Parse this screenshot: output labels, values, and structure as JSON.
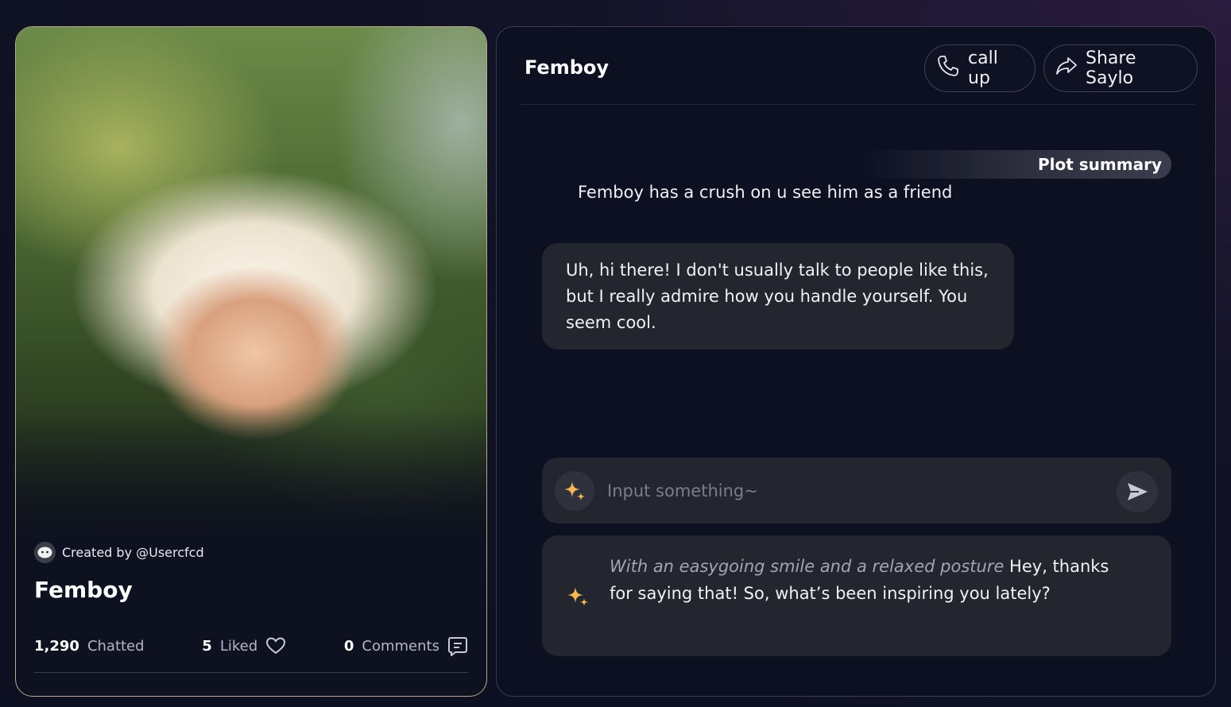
{
  "character_card": {
    "creator_label": "Created by @Usercfcd",
    "name": "Femboy",
    "stats": {
      "chatted_count": "1,290",
      "chatted_label": "Chatted",
      "liked_count": "5",
      "liked_label": "Liked",
      "comments_count": "0",
      "comments_label": "Comments"
    }
  },
  "chat": {
    "title": "Femboy",
    "call_label": "call up",
    "share_label": "Share Saylo",
    "plot_summary_label": "Plot summary",
    "plot_summary_text": "Femboy has a crush on u see him as a friend",
    "messages": [
      {
        "text": "Uh, hi there! I don't usually talk to people like this, but I really admire how you handle yourself. You seem cool."
      }
    ],
    "input": {
      "placeholder": "Input something~",
      "value": ""
    },
    "suggestion": {
      "action": "With an easygoing smile and a relaxed posture",
      "speech": " Hey, thanks for saying that! So, what’s been inspiring you lately?"
    }
  },
  "colors": {
    "accent_gold": "#f3b74e",
    "card_border": "#b7a888",
    "bubble_bg": "#23252f"
  },
  "icons": [
    "user-face-icon",
    "heart-icon",
    "comment-icon",
    "phone-icon",
    "share-arrow-icon",
    "sparkle-icon",
    "send-icon"
  ]
}
